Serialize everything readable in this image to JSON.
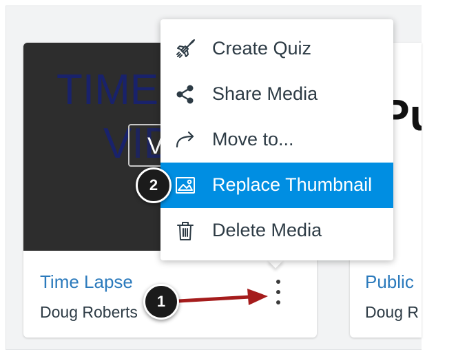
{
  "cards": [
    {
      "thumb_line1": "TIME",
      "thumb_line2": "VID",
      "view_badge": "V",
      "title": "Time Lapse",
      "owner": "Doug Roberts"
    },
    {
      "thumb_text": "Pu",
      "title": "Public",
      "owner": "Doug R"
    }
  ],
  "menu": {
    "items": [
      {
        "label": "Create Quiz",
        "icon": "rocket-icon"
      },
      {
        "label": "Share Media",
        "icon": "share-icon"
      },
      {
        "label": "Move to...",
        "icon": "move-arrow-icon"
      },
      {
        "label": "Replace Thumbnail",
        "icon": "image-icon",
        "active": true
      },
      {
        "label": "Delete Media",
        "icon": "trash-icon"
      }
    ]
  },
  "steps": [
    "1",
    "2"
  ],
  "colors": {
    "accent": "#008ee2",
    "link": "#2b7abc",
    "arrow": "#a51c1c",
    "thumb_bg": "#2d2d2d",
    "thumb_text": "#19226b"
  }
}
